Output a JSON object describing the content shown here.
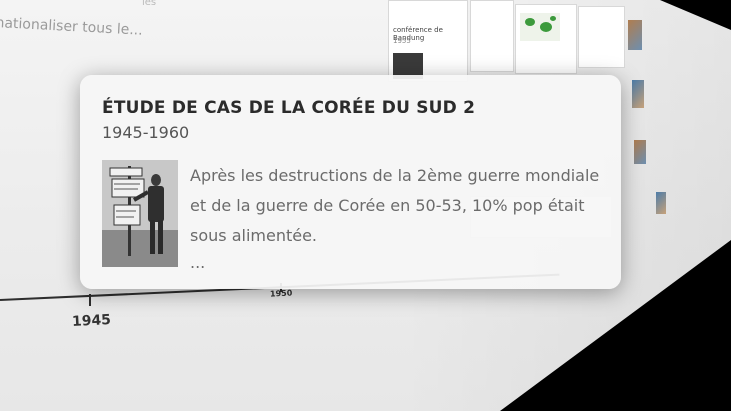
{
  "background": {
    "snippet_text": "nationaliser tous le...",
    "snippet_small": "les",
    "card_title": "conférence de Bandung",
    "card_year": "1955",
    "axis_years": [
      "1945",
      "1950"
    ]
  },
  "popup": {
    "title": "ÉTUDE DE CAS DE LA CORÉE DU SUD 2",
    "subtitle": "1945-1960",
    "body": "Après les destructions de la 2ème guerre mondiale et de la guerre de Corée en 50-53, 10% pop était sous alimentée.",
    "ellipsis": "...",
    "image_icon": "historical-photo-soldier-with-signs"
  }
}
